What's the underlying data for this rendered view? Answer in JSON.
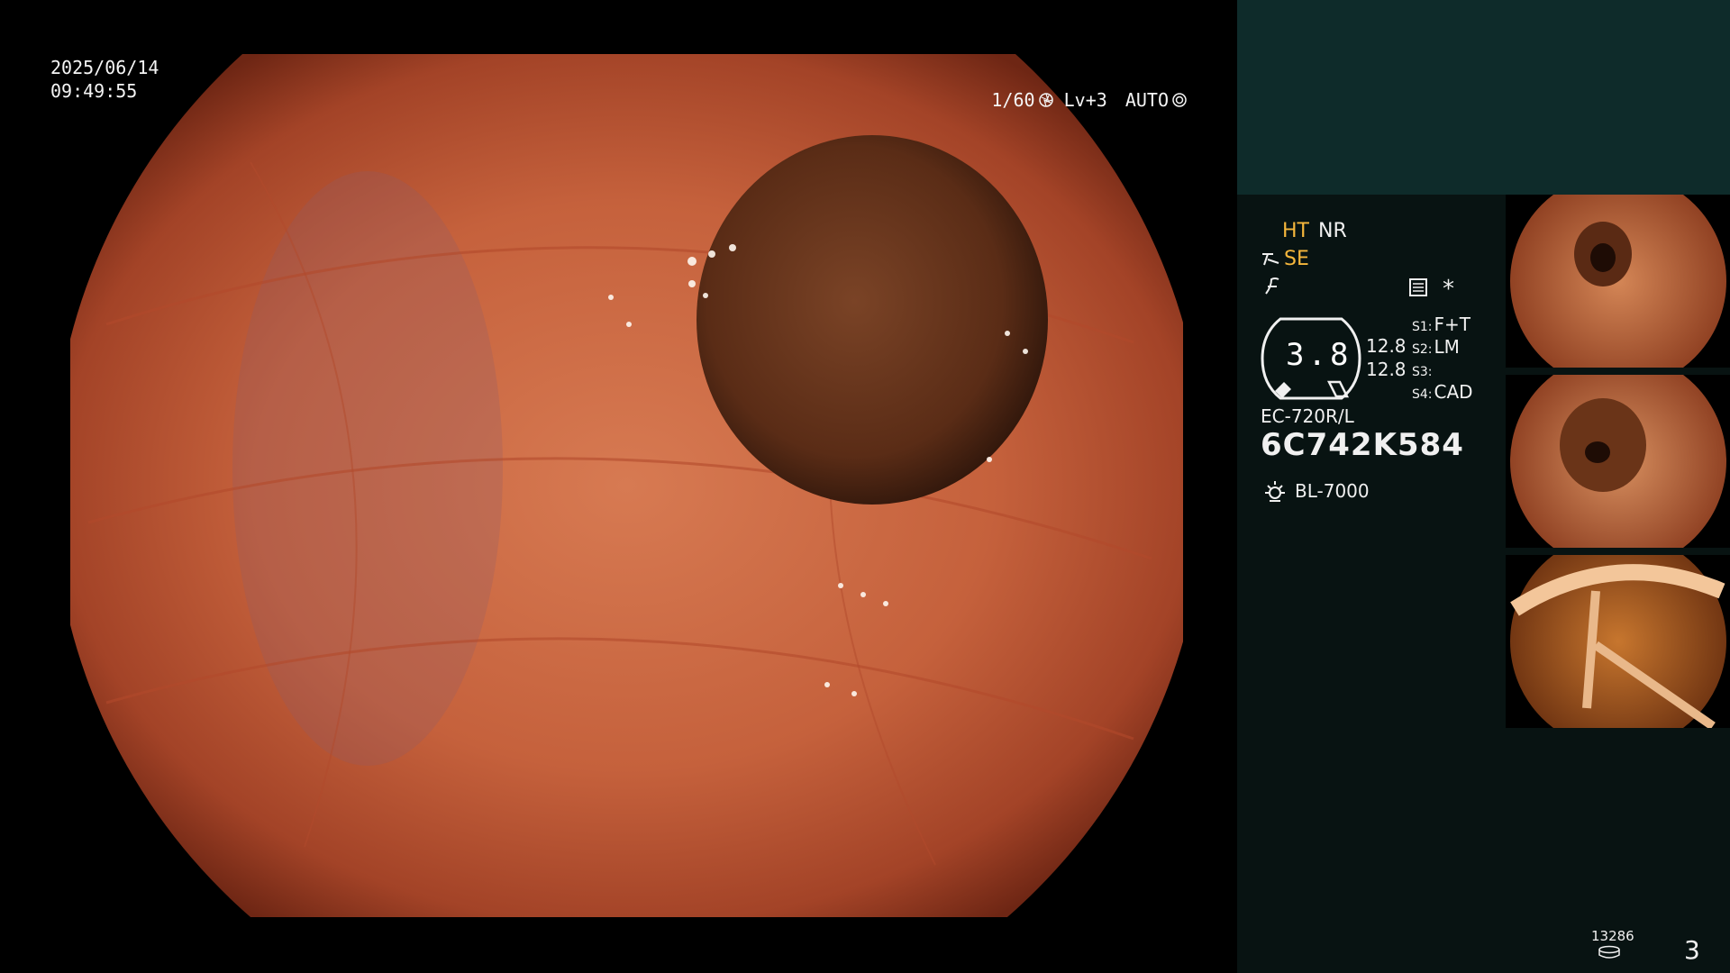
{
  "video": {
    "date": "2025/06/14",
    "time": "09:49:55",
    "shutter": "1/60",
    "level": "Lv+3",
    "mode": "AUTO"
  },
  "panel": {
    "mode_ht": "HT",
    "mode_nr": "NR",
    "mode_se": "SE",
    "asterisk": "*",
    "gauge_value": "3.8",
    "gauge_right_1": "12.8",
    "gauge_right_2": "12.8",
    "s1_key": "S1:",
    "s1_val": "F+T",
    "s2_key": "S2:",
    "s2_val": "LM",
    "s3_key": "S3:",
    "s3_val": "",
    "s4_key": "S4:",
    "s4_val": "CAD",
    "scope_model": "EC-720R/L",
    "scope_serial": "6C742K584",
    "light_source": "BL-7000",
    "record_count": "13286",
    "page_number": "3"
  },
  "colors": {
    "accent_orange": "#f6b73c",
    "panel_bg": "#081312",
    "panel_top_bg": "#0e2b2a"
  },
  "icons": [
    "shutter-icon",
    "iris-icon",
    "se-mode-icon",
    "filter-icon",
    "settings-icon",
    "light-source-icon",
    "record-stack-icon"
  ]
}
